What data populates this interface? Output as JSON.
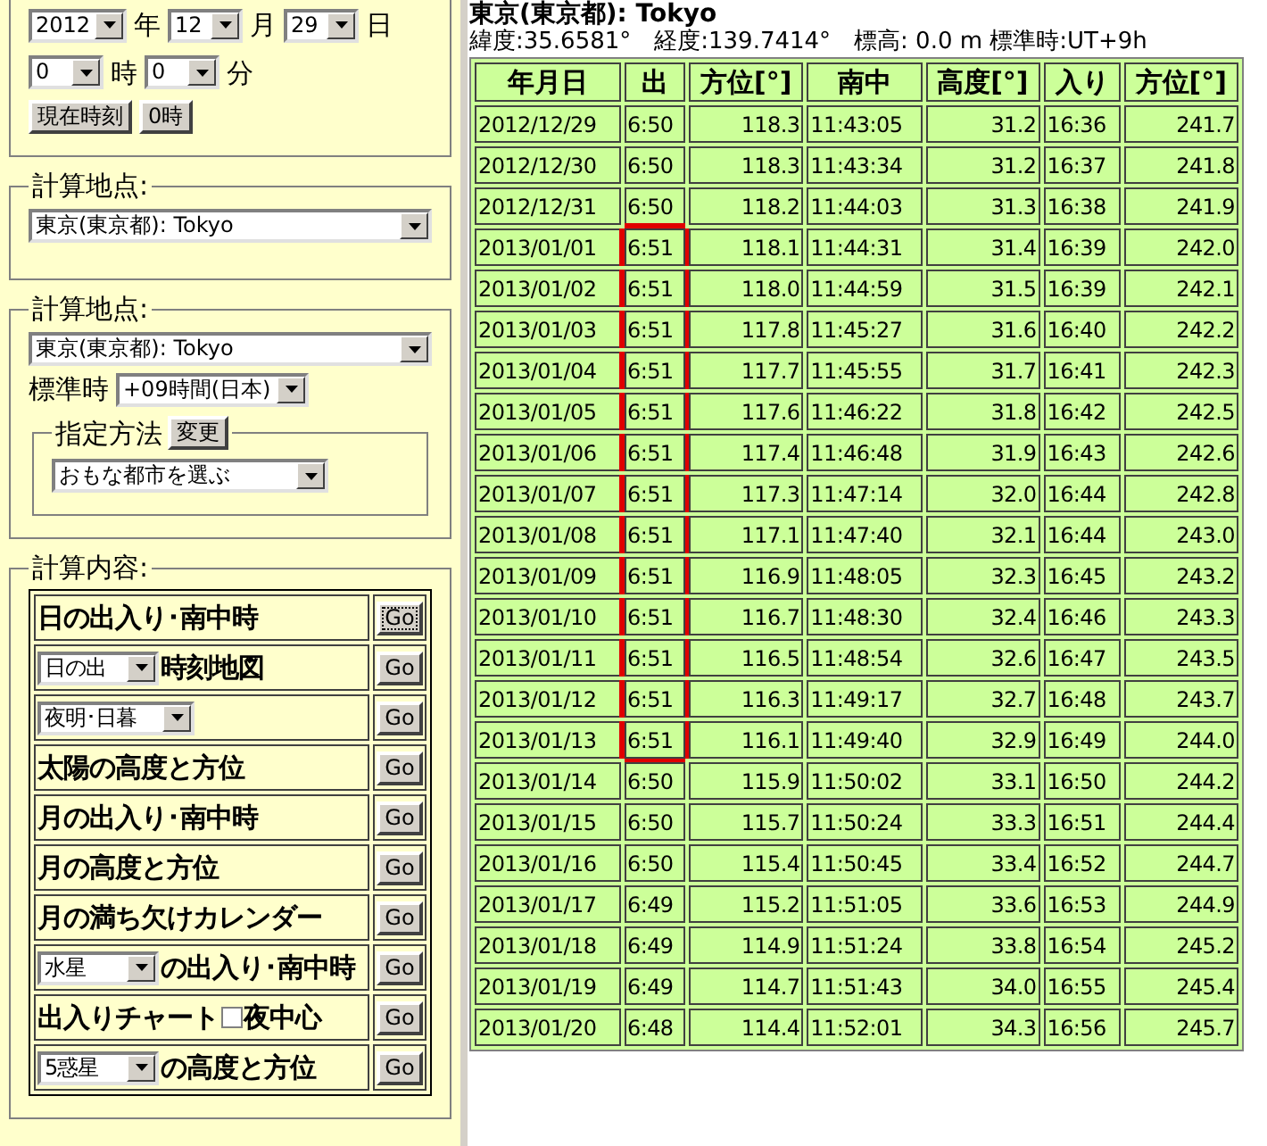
{
  "date_time": {
    "year": "2012",
    "year_unit": "年",
    "month": "12",
    "month_unit": "月",
    "day": "29",
    "day_unit": "日",
    "hour": "0",
    "hour_unit": "時",
    "minute": "0",
    "minute_unit": "分",
    "buttons": [
      "現在時刻",
      "0時"
    ]
  },
  "location_simple": {
    "legend": "計算地点:",
    "city": "東京(東京都): Tokyo"
  },
  "location": {
    "legend": "計算地点:",
    "city": "東京(東京都): Tokyo",
    "timezone_label": "標準時",
    "timezone": "+09時間(日本)",
    "method": {
      "legend": "指定方法",
      "button": "変更",
      "choice": "おもな都市を選ぶ"
    }
  },
  "calculations": {
    "legend": "計算内容:",
    "items": [
      {
        "kind": "text",
        "text": "日の出入り･南中時",
        "button": "Go",
        "focused": true
      },
      {
        "kind": "select",
        "select": "日の出",
        "text": "時刻地図",
        "button": "Go",
        "focused": false
      },
      {
        "kind": "select",
        "select": "夜明･日暮",
        "button": "Go",
        "focused": false
      },
      {
        "kind": "text",
        "text": "太陽の高度と方位",
        "button": "Go",
        "focused": false
      },
      {
        "kind": "text",
        "text": "月の出入り･南中時",
        "button": "Go",
        "focused": false
      },
      {
        "kind": "text",
        "text": "月の高度と方位",
        "button": "Go",
        "focused": false
      },
      {
        "kind": "text",
        "text": "月の満ち欠けカレンダー",
        "button": "Go",
        "focused": false
      },
      {
        "kind": "select",
        "select": "水星",
        "text": "の出入り･南中時",
        "button": "Go",
        "focused": false
      },
      {
        "kind": "checkbox",
        "text": "出入りチャート",
        "checkbox_label": "夜中心",
        "checked": false,
        "button": "Go",
        "focused": false
      },
      {
        "kind": "select",
        "select": "5惑星",
        "text": "の高度と方位",
        "button": "Go",
        "focused": false
      }
    ]
  },
  "result": {
    "title": "東京(東京都): Tokyo",
    "info": "緯度:35.6581°　経度:139.7414°　標高: 0.0 m 標準時:UT+9h",
    "table": {
      "columns": [
        "年月日",
        "出",
        "方位[°]",
        "南中",
        "高度[°]",
        "入り",
        "方位[°]"
      ],
      "rows": [
        {
          "cells": [
            "2012/12/29",
            "6:50",
            "118.3",
            "11:43:05",
            "31.2",
            "16:36",
            "241.7"
          ],
          "marked": false
        },
        {
          "cells": [
            "2012/12/30",
            "6:50",
            "118.3",
            "11:43:34",
            "31.2",
            "16:37",
            "241.8"
          ],
          "marked": false
        },
        {
          "cells": [
            "2012/12/31",
            "6:50",
            "118.2",
            "11:44:03",
            "31.3",
            "16:38",
            "241.9"
          ],
          "marked": false
        },
        {
          "cells": [
            "2013/01/01",
            "6:51",
            "118.1",
            "11:44:31",
            "31.4",
            "16:39",
            "242.0"
          ],
          "marked": true
        },
        {
          "cells": [
            "2013/01/02",
            "6:51",
            "118.0",
            "11:44:59",
            "31.5",
            "16:39",
            "242.1"
          ],
          "marked": true
        },
        {
          "cells": [
            "2013/01/03",
            "6:51",
            "117.8",
            "11:45:27",
            "31.6",
            "16:40",
            "242.2"
          ],
          "marked": true
        },
        {
          "cells": [
            "2013/01/04",
            "6:51",
            "117.7",
            "11:45:55",
            "31.7",
            "16:41",
            "242.3"
          ],
          "marked": true
        },
        {
          "cells": [
            "2013/01/05",
            "6:51",
            "117.6",
            "11:46:22",
            "31.8",
            "16:42",
            "242.5"
          ],
          "marked": true
        },
        {
          "cells": [
            "2013/01/06",
            "6:51",
            "117.4",
            "11:46:48",
            "31.9",
            "16:43",
            "242.6"
          ],
          "marked": true
        },
        {
          "cells": [
            "2013/01/07",
            "6:51",
            "117.3",
            "11:47:14",
            "32.0",
            "16:44",
            "242.8"
          ],
          "marked": true
        },
        {
          "cells": [
            "2013/01/08",
            "6:51",
            "117.1",
            "11:47:40",
            "32.1",
            "16:44",
            "243.0"
          ],
          "marked": true
        },
        {
          "cells": [
            "2013/01/09",
            "6:51",
            "116.9",
            "11:48:05",
            "32.3",
            "16:45",
            "243.2"
          ],
          "marked": true
        },
        {
          "cells": [
            "2013/01/10",
            "6:51",
            "116.7",
            "11:48:30",
            "32.4",
            "16:46",
            "243.3"
          ],
          "marked": true
        },
        {
          "cells": [
            "2013/01/11",
            "6:51",
            "116.5",
            "11:48:54",
            "32.6",
            "16:47",
            "243.5"
          ],
          "marked": true
        },
        {
          "cells": [
            "2013/01/12",
            "6:51",
            "116.3",
            "11:49:17",
            "32.7",
            "16:48",
            "243.7"
          ],
          "marked": true
        },
        {
          "cells": [
            "2013/01/13",
            "6:51",
            "116.1",
            "11:49:40",
            "32.9",
            "16:49",
            "244.0"
          ],
          "marked": true
        },
        {
          "cells": [
            "2013/01/14",
            "6:50",
            "115.9",
            "11:50:02",
            "33.1",
            "16:50",
            "244.2"
          ],
          "marked": false
        },
        {
          "cells": [
            "2013/01/15",
            "6:50",
            "115.7",
            "11:50:24",
            "33.3",
            "16:51",
            "244.4"
          ],
          "marked": false
        },
        {
          "cells": [
            "2013/01/16",
            "6:50",
            "115.4",
            "11:50:45",
            "33.4",
            "16:52",
            "244.7"
          ],
          "marked": false
        },
        {
          "cells": [
            "2013/01/17",
            "6:49",
            "115.2",
            "11:51:05",
            "33.6",
            "16:53",
            "244.9"
          ],
          "marked": false
        },
        {
          "cells": [
            "2013/01/18",
            "6:49",
            "114.9",
            "11:51:24",
            "33.8",
            "16:54",
            "245.2"
          ],
          "marked": false
        },
        {
          "cells": [
            "2013/01/19",
            "6:49",
            "114.7",
            "11:51:43",
            "34.0",
            "16:55",
            "245.4"
          ],
          "marked": false
        },
        {
          "cells": [
            "2013/01/20",
            "6:48",
            "114.4",
            "11:52:01",
            "34.3",
            "16:56",
            "245.7"
          ],
          "marked": false
        }
      ]
    }
  }
}
